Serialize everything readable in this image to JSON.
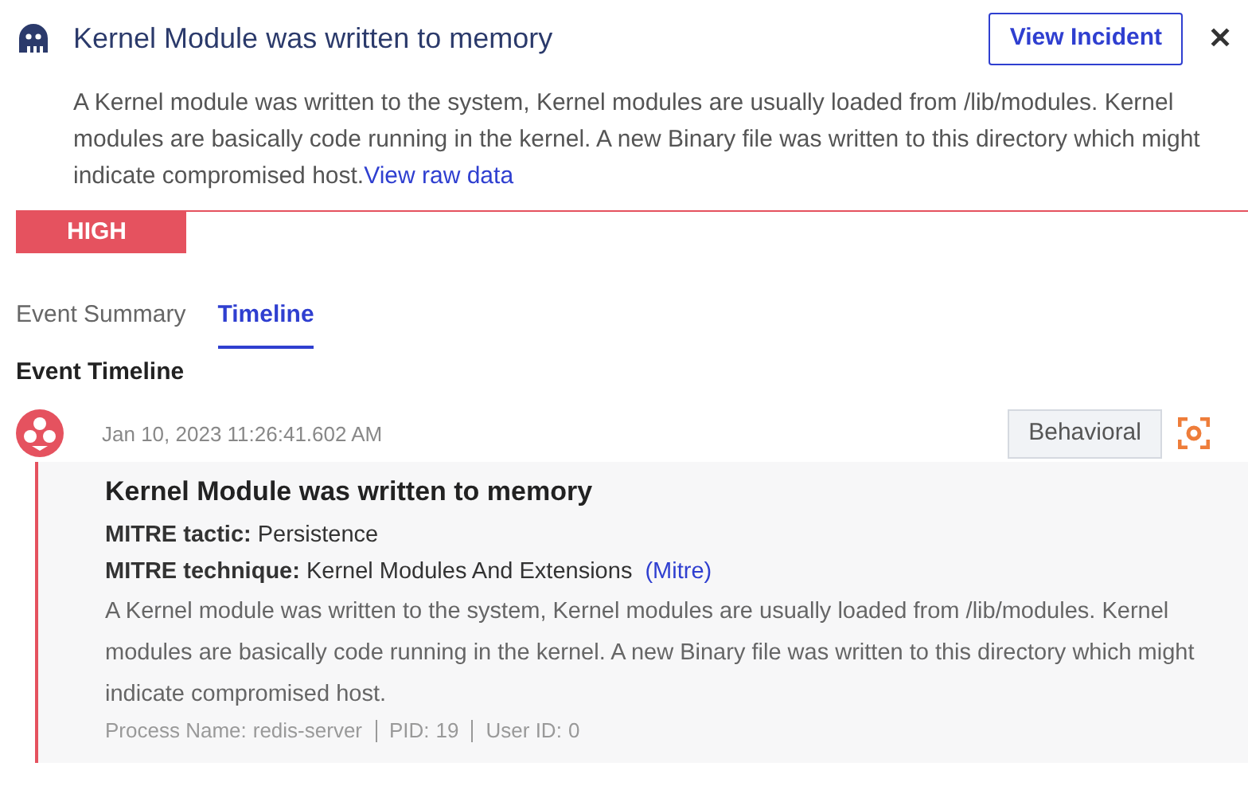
{
  "header": {
    "title": "Kernel Module was written to memory",
    "action": "View Incident",
    "close": "✕"
  },
  "description": {
    "text": "A Kernel module was written to the system, Kernel modules are usually loaded from /lib/modules. Kernel modules are basically code running in the kernel. A new Binary file was written to this directory which might indicate compromised host.",
    "link": "View raw data"
  },
  "severity": {
    "label": "HIGH",
    "color": "#e5525f"
  },
  "tabs": [
    {
      "label": "Event Summary",
      "selected": false
    },
    {
      "label": "Timeline",
      "selected": true
    }
  ],
  "section_title": "Event Timeline",
  "events": [
    {
      "time": "Jan 10, 2023 11:26:41.602 AM",
      "tag": "Behavioral",
      "title": "Kernel Module was written to memory",
      "fields": [
        {
          "label": "MITRE tactic:",
          "value": "Persistence"
        },
        {
          "label": "MITRE technique:",
          "value": "Kernel Modules And Extensions",
          "link": "(Mitre)"
        }
      ],
      "description": "A Kernel module was written to the system, Kernel modules are usually loaded from /lib/modules. Kernel modules are basically code running in the kernel. A new Binary file was written to this directory which might indicate compromised host.",
      "meta": [
        {
          "label": "Process Name:",
          "value": "redis-server"
        },
        {
          "label": "PID:",
          "value": "19"
        },
        {
          "label": "User ID:",
          "value": "0"
        }
      ]
    }
  ]
}
